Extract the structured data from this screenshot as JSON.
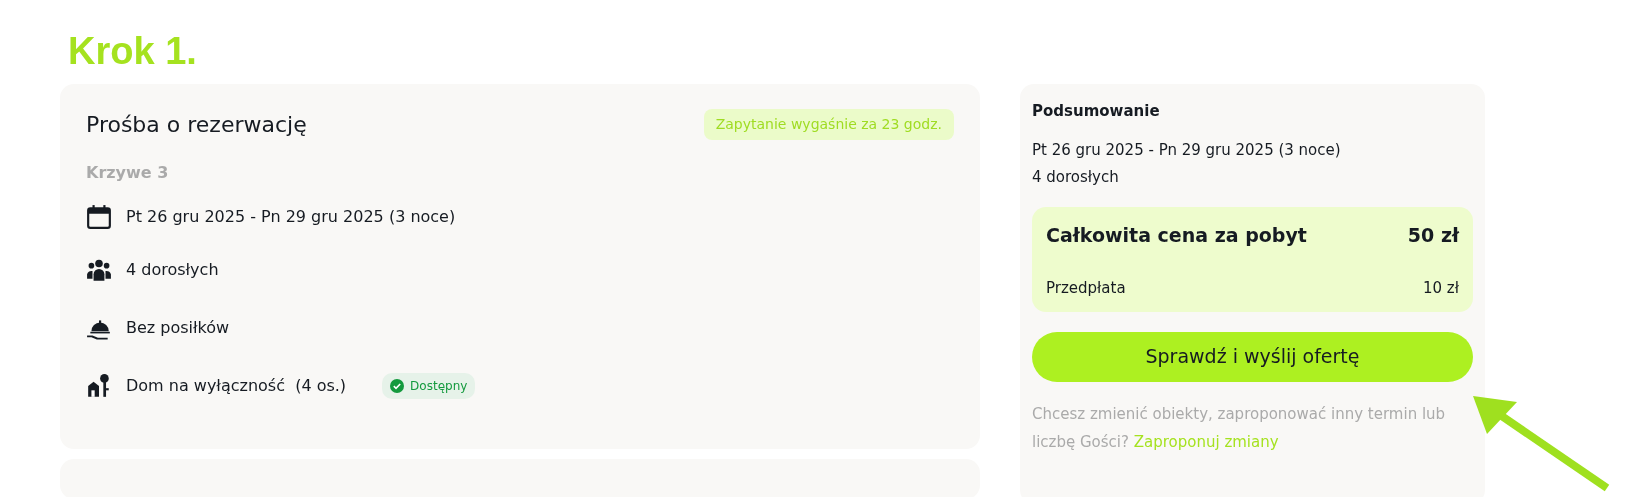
{
  "step_heading": "Krok 1.",
  "request": {
    "title": "Prośba o rezerwację",
    "expiry_badge": "Zapytanie wygaśnie za 23 godz.",
    "property": "Krzywe 3",
    "details": [
      {
        "kind": "dates",
        "text": "Pt 26 gru 2025 - Pn 29 gru 2025 (3 noce)"
      },
      {
        "kind": "guests",
        "text": "4 dorosłych"
      },
      {
        "kind": "meals",
        "text": "Bez posiłków"
      },
      {
        "kind": "unit",
        "text": "Dom na wyłączność  (4 os.)",
        "badge": "Dostępny"
      }
    ]
  },
  "summary": {
    "title": "Podsumowanie",
    "dates": "Pt 26 gru 2025 - Pn 29 gru 2025 (3 noce)",
    "guests": "4 dorosłych",
    "total_label": "Całkowita cena za pobyt",
    "total_value": "50 zł",
    "prepay_label": "Przedpłata",
    "prepay_value": "10 zł",
    "button": "Sprawdź i wyślij ofertę",
    "note": "Chcesz zmienić obiekty, zaproponować inny termin lub liczbę Gości?",
    "note_link": "Zaproponuj zmiany"
  }
}
